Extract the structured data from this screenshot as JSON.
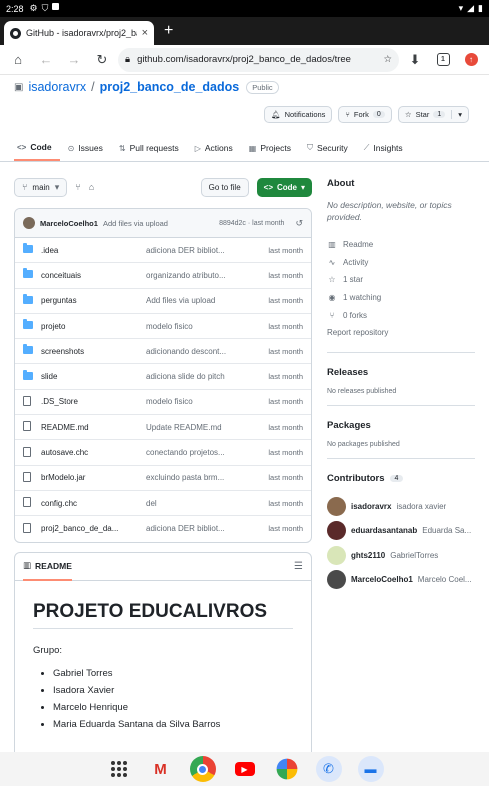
{
  "status": {
    "time": "2:28"
  },
  "tab": {
    "title": "GitHub - isadoravrx/proj2_ba",
    "close": "×",
    "new": "+"
  },
  "toolbar": {
    "url": "github.com/isadoravrx/proj2_banco_de_dados/tree",
    "tab_count": "1"
  },
  "repo": {
    "owner": "isadoravrx",
    "separator": "/",
    "name": "proj2_banco_de_dados",
    "visibility": "Public"
  },
  "actions": {
    "notifications": "Notifications",
    "fork": "Fork",
    "fork_count": "0",
    "star": "Star",
    "star_count": "1"
  },
  "nav_tabs": [
    "Code",
    "Issues",
    "Pull requests",
    "Actions",
    "Projects",
    "Security",
    "Insights"
  ],
  "branch": {
    "name": "main",
    "goto": "Go to file",
    "code": "Code"
  },
  "commit": {
    "author": "MarceloCoelho1",
    "message": "Add files via upload",
    "sha": "8894d2c · last month"
  },
  "files": [
    {
      "name": ".idea",
      "msg": "adiciona DER bibliot...",
      "age": "last month",
      "type": "folder"
    },
    {
      "name": "conceituais",
      "msg": "organizando atributo...",
      "age": "last month",
      "type": "folder"
    },
    {
      "name": "perguntas",
      "msg": "Add files via upload",
      "age": "last month",
      "type": "folder"
    },
    {
      "name": "projeto",
      "msg": "modelo fisico",
      "age": "last month",
      "type": "folder"
    },
    {
      "name": "screenshots",
      "msg": "adicionando descont...",
      "age": "last month",
      "type": "folder"
    },
    {
      "name": "slide",
      "msg": "adiciona slide do pitch",
      "age": "last month",
      "type": "folder"
    },
    {
      "name": ".DS_Store",
      "msg": "modelo fisico",
      "age": "last month",
      "type": "file"
    },
    {
      "name": "README.md",
      "msg": "Update README.md",
      "age": "last month",
      "type": "file"
    },
    {
      "name": "autosave.chc",
      "msg": "conectando projetos...",
      "age": "last month",
      "type": "file"
    },
    {
      "name": "brModelo.jar",
      "msg": "excluindo pasta brm...",
      "age": "last month",
      "type": "file"
    },
    {
      "name": "config.chc",
      "msg": "del",
      "age": "last month",
      "type": "file"
    },
    {
      "name": "proj2_banco_de_da...",
      "msg": "adiciona DER bibliot...",
      "age": "last month",
      "type": "file"
    }
  ],
  "readme": {
    "label": "README",
    "heading": "PROJETO EDUCALIVROS",
    "intro": "Grupo:",
    "members": [
      "Gabriel Torres",
      "Isadora Xavier",
      "Marcelo Henrique",
      "Maria Eduarda Santana da Silva Barros"
    ]
  },
  "about": {
    "title": "About",
    "description": "No description, website, or topics provided.",
    "readme": "Readme",
    "activity": "Activity",
    "stars": "1 star",
    "watching": "1 watching",
    "forks": "0 forks",
    "report": "Report repository"
  },
  "releases": {
    "title": "Releases",
    "text": "No releases published"
  },
  "packages": {
    "title": "Packages",
    "text": "No packages published"
  },
  "contributors": {
    "title": "Contributors",
    "count": "4",
    "list": [
      {
        "login": "isadoravrx",
        "name": "isadora xavier",
        "color": "#8a6a4e"
      },
      {
        "login": "eduardasantanab",
        "name": "Eduarda Sa...",
        "color": "#5a2a2a"
      },
      {
        "login": "ghts2110",
        "name": "GabrielTorres",
        "color": "#d9e6b8"
      },
      {
        "login": "MarceloCoelho1",
        "name": "Marcelo Coel...",
        "color": "#4a4a4a"
      }
    ]
  },
  "colors": {
    "accent": "#0969da",
    "green": "#1f883d",
    "tab_underline": "#fd8c73"
  }
}
